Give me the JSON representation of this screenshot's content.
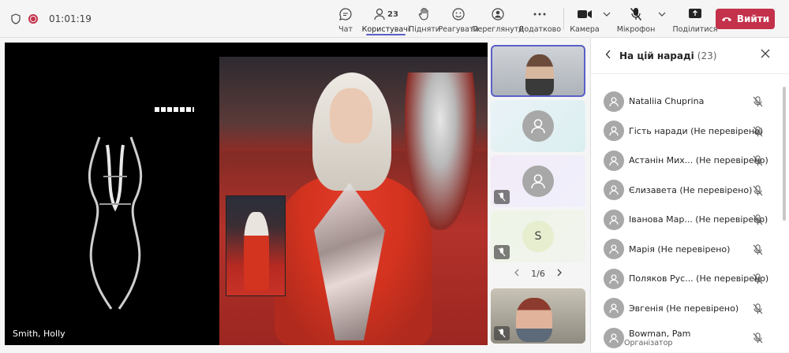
{
  "topbar": {
    "timer": "01:01:19",
    "buttons": [
      {
        "label": "Чат",
        "icon": "chat-icon"
      },
      {
        "label": "Користувачі",
        "icon": "people-icon",
        "count": "23"
      },
      {
        "label": "Підняти",
        "icon": "raise-hand-icon"
      },
      {
        "label": "Реагувати",
        "icon": "react-icon"
      },
      {
        "label": "Переглянути",
        "icon": "view-icon"
      },
      {
        "label": "Додатково",
        "icon": "more-icon"
      },
      {
        "label": "Камера",
        "icon": "camera-icon"
      },
      {
        "label": "Мікрофон",
        "icon": "mic-off-icon"
      },
      {
        "label": "Поділитися",
        "icon": "share-icon"
      }
    ],
    "leave_label": "Вийти"
  },
  "stage": {
    "caption": "Smith, Holly"
  },
  "tiles": {
    "initial": "S",
    "pager": "1/6"
  },
  "panel": {
    "title": "На цій нараді",
    "count": "(23)",
    "participants": [
      {
        "name": "Nataliia Chuprina"
      },
      {
        "name": "Гість наради (Не перевірено)"
      },
      {
        "name": "Астанін Мих...  (Не перевірено)"
      },
      {
        "name": "Єлизавета (Не перевірено)"
      },
      {
        "name": "Іванова Мар...  (Не перевірено)"
      },
      {
        "name": "Марія (Не перевірено)"
      },
      {
        "name": "Поляков Рус...  (Не перевірено)"
      },
      {
        "name": "Эвгенія (Не перевірено)"
      },
      {
        "name": "Bowman, Pam",
        "role": "Організатор"
      }
    ]
  },
  "colors": {
    "accent": "#5b5fc7",
    "leave": "#c4314b"
  }
}
